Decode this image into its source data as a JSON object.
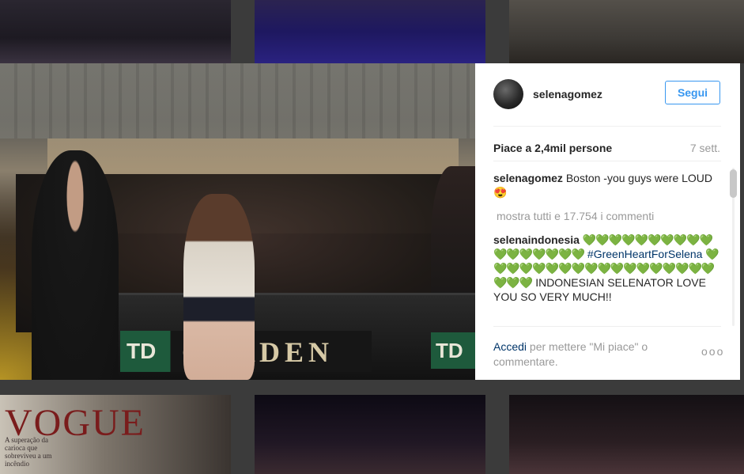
{
  "background": {
    "vogue_title": "VOGUE",
    "vogue_caption": "A superação da carioca que sobreviveu a um incêndio"
  },
  "photo": {
    "sign_logo": "TD",
    "sign_text": "GARDEN",
    "sign_logo_right": "TD"
  },
  "post": {
    "username": "selenagomez",
    "follow_label": "Segui",
    "likes": "Piace a 2,4mil persone",
    "age": "7 sett.",
    "caption_user": "selenagomez",
    "caption_text": "Boston -you guys were LOUD 😍",
    "view_all": "mostra tutti e 17.754 i commenti",
    "comment_user": "selenaindonesia",
    "comment_hearts_1": "💚💚💚💚💚💚💚💚💚💚💚💚💚💚💚💚💚",
    "comment_hashtag": "#GreenHeartForSelena",
    "comment_hearts_2": "💚💚💚💚💚💚💚💚💚💚💚💚💚💚💚💚💚💚💚💚💚",
    "comment_text": "INDONESIAN SELENATOR LOVE YOU SO VERY MUCH!!",
    "login_link": "Accedi",
    "login_text": " per mettere \"Mi piace\" o commentare.",
    "more_label": "ooo"
  },
  "colors": {
    "link": "#003569",
    "follow_blue": "#3897f0",
    "muted": "#999999"
  }
}
